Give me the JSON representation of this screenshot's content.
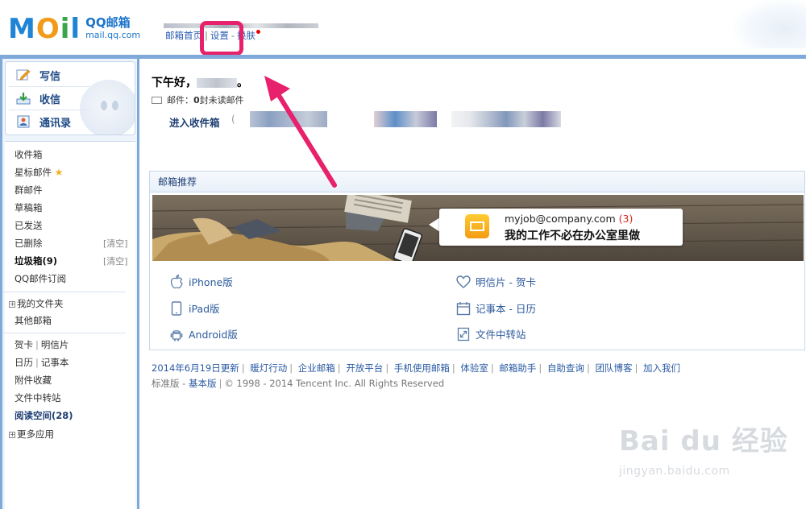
{
  "logo": {
    "brand": "MOil",
    "title": "QQ邮箱",
    "url": "mail.qq.com"
  },
  "topnav": {
    "home": "邮箱首页",
    "settings": "设置",
    "skin": "换肤"
  },
  "sidebar": {
    "write": "写信",
    "inbox": "收信",
    "contacts": "通讯录",
    "folders": {
      "inbox": "收件箱",
      "starred": "星标邮件",
      "group": "群邮件",
      "drafts": "草稿箱",
      "sent": "已发送",
      "deleted": "已删除",
      "deleted_clear": "[清空]",
      "spam": "垃圾箱(9)",
      "spam_clear": "[清空]",
      "subscribe": "QQ邮件订阅",
      "my_folders": "我的文件夹",
      "other_mail": "其他邮箱",
      "card": "贺卡",
      "postcard": "明信片",
      "calendar": "日历",
      "notes": "记事本",
      "attachments": "附件收藏",
      "transfer": "文件中转站",
      "reading": "阅读空间(28)",
      "more_apps": "更多应用"
    }
  },
  "main": {
    "greeting": "下午好，",
    "greeting_end": "。",
    "mail_prefix": "邮件：",
    "unread_count": "0",
    "mail_suffix": " 封未读邮件",
    "enter_inbox": "进入收件箱"
  },
  "recommend": {
    "title": "邮箱推荐",
    "banner_email": "myjob@company.com",
    "banner_count": "(3)",
    "banner_slogan": "我的工作不必在办公室里做",
    "apps": {
      "iphone": "iPhone版",
      "ipad": "iPad版",
      "android": "Android版",
      "postcard": "明信片 - 贺卡",
      "notes": "记事本 - 日历",
      "transfer": "文件中转站"
    }
  },
  "footer": {
    "links": [
      "2014年6月19日更新",
      "暖灯行动",
      "企业邮箱",
      "开放平台",
      "手机使用邮箱",
      "体验室",
      "邮箱助手",
      "自助查询",
      "团队博客",
      "加入我们"
    ],
    "standard": "标准版",
    "basic": "基本版",
    "copyright": "© 1998 - 2014 Tencent Inc. All Rights Reserved"
  },
  "watermark": {
    "brand": "Bai du 经验",
    "url": "jingyan.baidu.com"
  },
  "colors": {
    "frame": "#7ea9d9",
    "highlight": "#e8216d",
    "link": "#2a5db0"
  }
}
